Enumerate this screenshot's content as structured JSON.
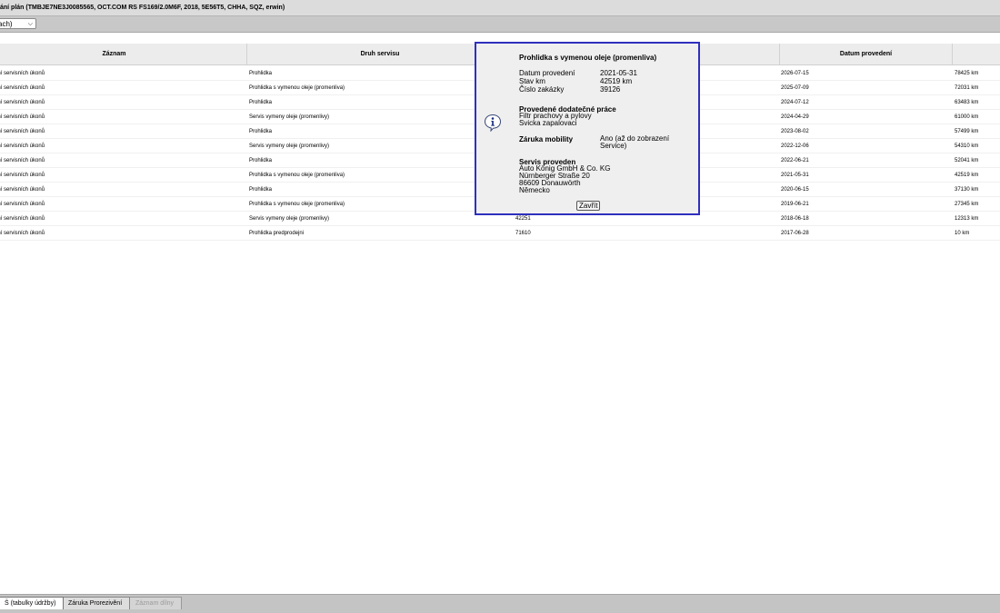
{
  "window": {
    "title": "ání plán (TMBJE7NE3J0085565, OCT.COM RS FS169/2.0M6F, 2018, 5E56T5, CHHA, SQZ, erwin)"
  },
  "filter": {
    "selected": "ach)"
  },
  "table": {
    "columns": [
      "Záznam",
      "Druh servisu",
      "",
      "Datum provedení",
      ""
    ],
    "rows": [
      {
        "record": "ení servisních úkonů",
        "type": "Prohlidka",
        "order": "",
        "date": "2026-07-15",
        "km": "78425 km"
      },
      {
        "record": "ení servisních úkonů",
        "type": "Prohlidka s vymenou oleje (promenliva)",
        "order": "",
        "date": "2025-07-09",
        "km": "72031 km"
      },
      {
        "record": "ení servisních úkonů",
        "type": "Prohlidka",
        "order": "",
        "date": "2024-07-12",
        "km": "63483 km"
      },
      {
        "record": "ení servisních úkonů",
        "type": "Servis vymeny oleje (promenlivy)",
        "order": "",
        "date": "2024-04-29",
        "km": "61000 km"
      },
      {
        "record": "ení servisních úkonů",
        "type": "Prohlidka",
        "order": "",
        "date": "2023-08-02",
        "km": "57499 km"
      },
      {
        "record": "ení servisních úkonů",
        "type": "Servis vymeny oleje (promenlivy)",
        "order": "",
        "date": "2022-12-06",
        "km": "54310 km"
      },
      {
        "record": "ení servisních úkonů",
        "type": "Prohlidka",
        "order": "",
        "date": "2022-06-21",
        "km": "52041 km"
      },
      {
        "record": "ení servisních úkonů",
        "type": "Prohlidka s vymenou oleje (promenliva)",
        "order": "",
        "date": "2021-05-31",
        "km": "42519 km"
      },
      {
        "record": "ení servisních úkonů",
        "type": "Prohlidka",
        "order": "",
        "date": "2020-06-15",
        "km": "37130 km"
      },
      {
        "record": "ení servisních úkonů",
        "type": "Prohlidka s vymenou oleje (promenliva)",
        "order": "",
        "date": "2019-06-21",
        "km": "27345 km"
      },
      {
        "record": "ení servisních úkonů",
        "type": "Servis vymeny oleje (promenlivy)",
        "order": "42251",
        "date": "2018-06-18",
        "km": "12313 km"
      },
      {
        "record": "ení servisních úkonů",
        "type": "Prohlidka predprodejni",
        "order": "71610",
        "date": "2017-06-28",
        "km": "10 km"
      }
    ]
  },
  "popup": {
    "title": "Prohlidka s vymenou oleje (promenliva)",
    "fields": [
      {
        "label": "Datum provedení",
        "value": "2021-05-31"
      },
      {
        "label": "Stav km",
        "value": "42519 km"
      },
      {
        "label": "Číslo zakázky",
        "value": "39126"
      }
    ],
    "extra_work_heading": "Provedené dodatečné práce",
    "extra_work": [
      "Filtr prachovy a pylovy",
      "Svicka zapalovaci"
    ],
    "mobility_label": "Záruka mobility",
    "mobility_value_line1": "Ano (až do zobrazení",
    "mobility_value_line2": "Service)",
    "serviced_heading": "Servis proveden",
    "serviced_lines": [
      "Auto König GmbH & Co. KG",
      "Nürnberger Straße 20",
      "86609 Donauwörth",
      "Německo"
    ],
    "close_label": "Zavřít",
    "icon": "info-icon",
    "border_color": "#2f2fbf"
  },
  "tabs": [
    {
      "label": "Š (tabulky údržby)",
      "state": "active"
    },
    {
      "label": "Záruka Prorezivění",
      "state": "normal"
    },
    {
      "label": "Záznam dílny",
      "state": "disabled"
    }
  ]
}
